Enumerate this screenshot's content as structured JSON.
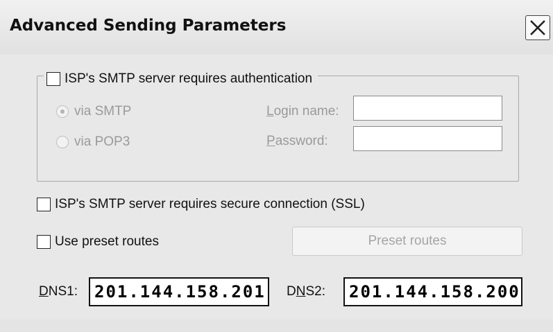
{
  "window": {
    "title": "Advanced Sending Parameters",
    "close_icon": "close-icon"
  },
  "auth": {
    "checkbox_label": "ISP's SMTP server requires authentication",
    "checked": false,
    "via_smtp": {
      "label": "via SMTP",
      "selected": true,
      "enabled": false
    },
    "via_pop3": {
      "label": "via POP3",
      "selected": false,
      "enabled": false
    },
    "login": {
      "label_hotkey": "L",
      "label_rest": "ogin name:",
      "value": ""
    },
    "password": {
      "label_hotkey": "P",
      "label_rest": "assword:",
      "value": ""
    }
  },
  "ssl": {
    "checkbox_label": "ISP's SMTP server requires secure connection (SSL)",
    "checked": false
  },
  "routes": {
    "checkbox_label": "Use preset routes",
    "checked": false,
    "button_label": "Preset routes",
    "button_enabled": false
  },
  "dns": {
    "dns1_hotkey": "D",
    "dns1_rest": "NS1:",
    "dns1_value": "201.144.158.201",
    "dns2_pre": "D",
    "dns2_hotkey": "N",
    "dns2_rest": "S2:",
    "dns2_value": "201.144.158.200"
  },
  "colors": {
    "dialog_bg": "#e8e8e8",
    "disabled_text": "#9a9a9a",
    "groupbox_border": "#a8a8a8"
  }
}
